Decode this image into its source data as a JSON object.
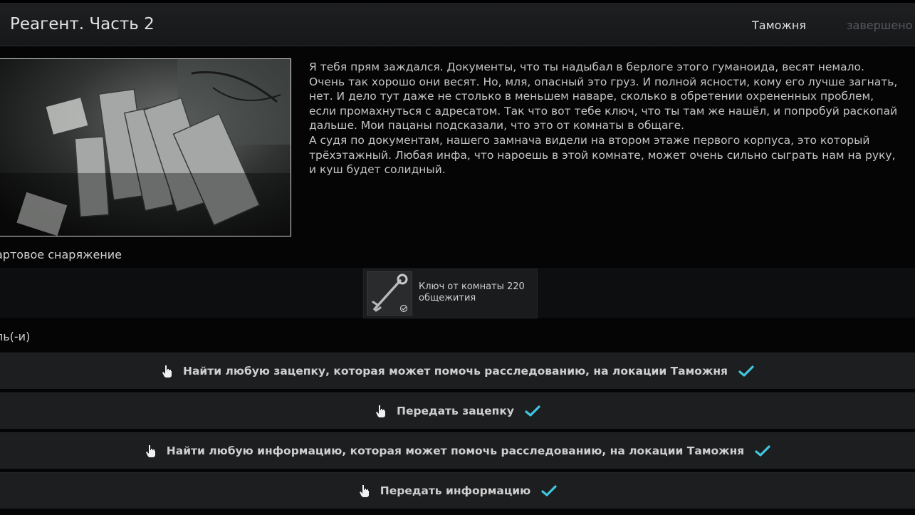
{
  "header": {
    "title": "Реагент. Часть 2",
    "location": "Таможня",
    "status": "завершено"
  },
  "description": "Я тебя прям заждался. Документы, что ты надыбал в берлоге этого гуманоида, весят немало. Очень так хорошо они весят. Но, мля, опасный это груз. И полной ясности, кому его лучше загнать, нет. И дело тут даже не столько в меньшем наваре, сколько в обретении охрененных проблем, если промахнуться с адресатом. Так что вот тебе ключ, что ты там же нашёл, и попробуй раскопай дальше. Мои пацаны подсказали, что это от комнаты в общаге.\nА судя по документам, нашего замнача видели на втором этаже первого корпуса, это который трёхэтажный. Любая инфа, что нароешь в этой комнате, может очень сильно сыграть нам на руку, и куш будет солидный.",
  "starting_gear": {
    "label": "артовое снаряжение",
    "item": {
      "name": "Ключ от комнаты 220 общежития",
      "icon": "key-icon"
    }
  },
  "objectives": {
    "label": "ль(-и)",
    "items": [
      {
        "text": "Найти любую зацепку, которая может помочь расследованию, на локации Таможня",
        "done": true
      },
      {
        "text": "Передать зацепку",
        "done": true
      },
      {
        "text": "Найти любую информацию, которая может помочь расследованию, на локации Таможня",
        "done": true
      },
      {
        "text": "Передать информацию",
        "done": true
      }
    ]
  },
  "colors": {
    "check": "#3fc6e0",
    "background": "#050505",
    "panel": "#1d1e20"
  }
}
